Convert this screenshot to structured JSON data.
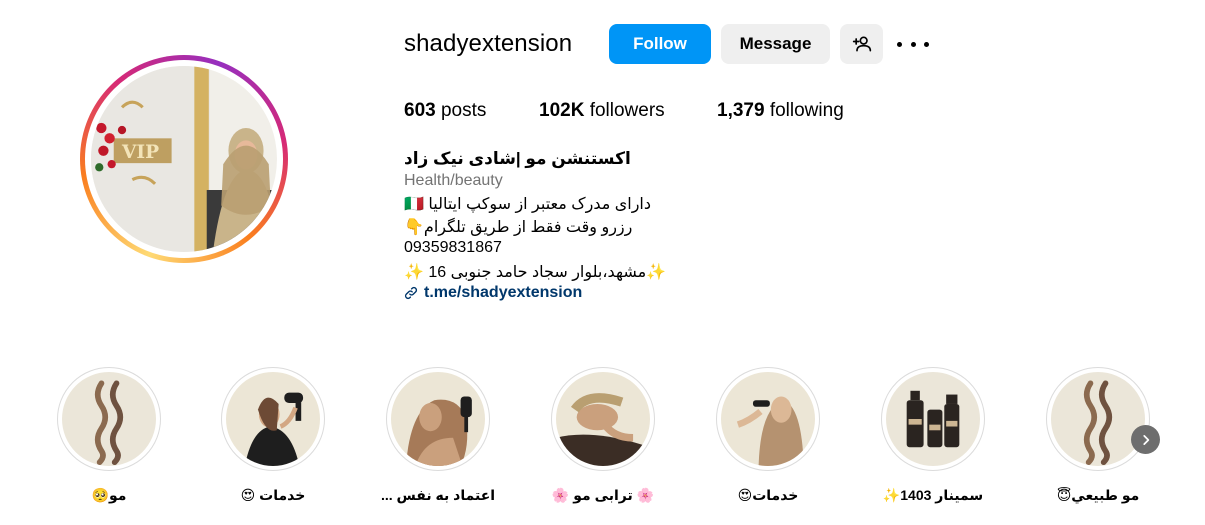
{
  "profile": {
    "username": "shadyextension",
    "follow_label": "Follow",
    "message_label": "Message",
    "stats": {
      "posts_count": "603",
      "posts_label": "posts",
      "followers_count": "102K",
      "followers_label": "followers",
      "following_count": "1,379",
      "following_label": "following"
    },
    "bio": {
      "name": "اکستنشن مو |شادی نیک زاد",
      "category": "Health/beauty",
      "line1": "دارای مدرک معتبر از سوکپ ایتالیا 🇮🇹",
      "line2": "رزرو وقت فقط از طریق تلگرام👇",
      "line3": "09359831867",
      "line4": "✨مشهد،بلوار سجاد حامد جنوبی 16 ✨",
      "link": "t.me/shadyextension"
    }
  },
  "highlights": [
    {
      "label": "مو🥺"
    },
    {
      "label": "خدمات 😍"
    },
    {
      "label": "اعتماد به نفس ..."
    },
    {
      "label": "🌸 ترابی مو 🌸"
    },
    {
      "label": "خدمات😍"
    },
    {
      "label": "سمینار 1403✨"
    },
    {
      "label": "مو طبيعي😇"
    }
  ],
  "colors": {
    "primary_button": "#0095f6",
    "secondary_button": "#efefef",
    "link": "#00376b",
    "muted_text": "#737373"
  },
  "icons": {
    "add_user": "add-user-icon",
    "more": "more-options-icon",
    "link": "link-icon",
    "next": "chevron-right-icon"
  }
}
